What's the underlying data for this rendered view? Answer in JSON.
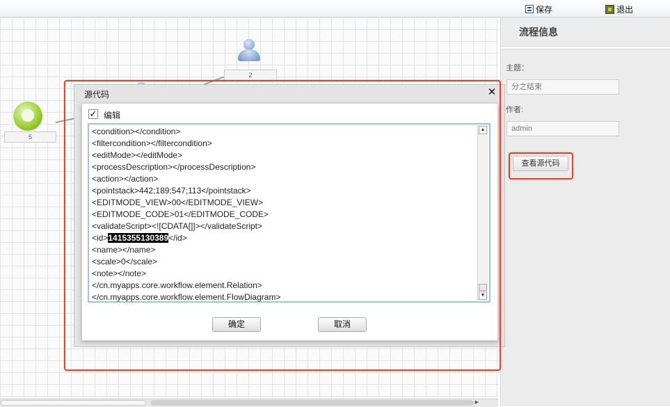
{
  "toolbar": {
    "save_label": "保存",
    "exit_label": "退出"
  },
  "canvas": {
    "nodes": [
      {
        "label": "5",
        "kind": "start"
      },
      {
        "label": "2",
        "kind": "person"
      }
    ]
  },
  "right_panel": {
    "title": "流程信息",
    "subject_label": "主题：",
    "subject_value": "分之结束",
    "author_label": "作者:",
    "author_value": "admin",
    "view_source_button": "查看源代码"
  },
  "dialog": {
    "title": "源代码",
    "close_icon": "close-icon",
    "edit_checkbox_label": "编辑",
    "edit_checked": true,
    "code_lines": [
      "<condition></condition>",
      "<filtercondition></filtercondition>",
      "<editMode></editMode>",
      "<processDescription></processDescription>",
      "<action></action>",
      "<pointstack>442;189;547;113</pointstack>",
      "<EDITMODE_VIEW>00</EDITMODE_VIEW>",
      "<EDITMODE_CODE>01</EDITMODE_CODE>",
      "<validateScript><![CDATA[]]></validateScript>",
      "<id>",
      "<name></name>",
      "<scale>0</scale>",
      "<note></note>",
      "</cn.myapps.core.workflow.element.Relation>",
      "</cn.myapps.core.workflow.element.FlowDiagram>"
    ],
    "id_value": "1415355130389",
    "id_suffix": "</id>",
    "ok_button": "确定",
    "cancel_button": "取消"
  },
  "colors": {
    "highlight_box": "#e0442c",
    "code_border": "#9cc3df"
  }
}
